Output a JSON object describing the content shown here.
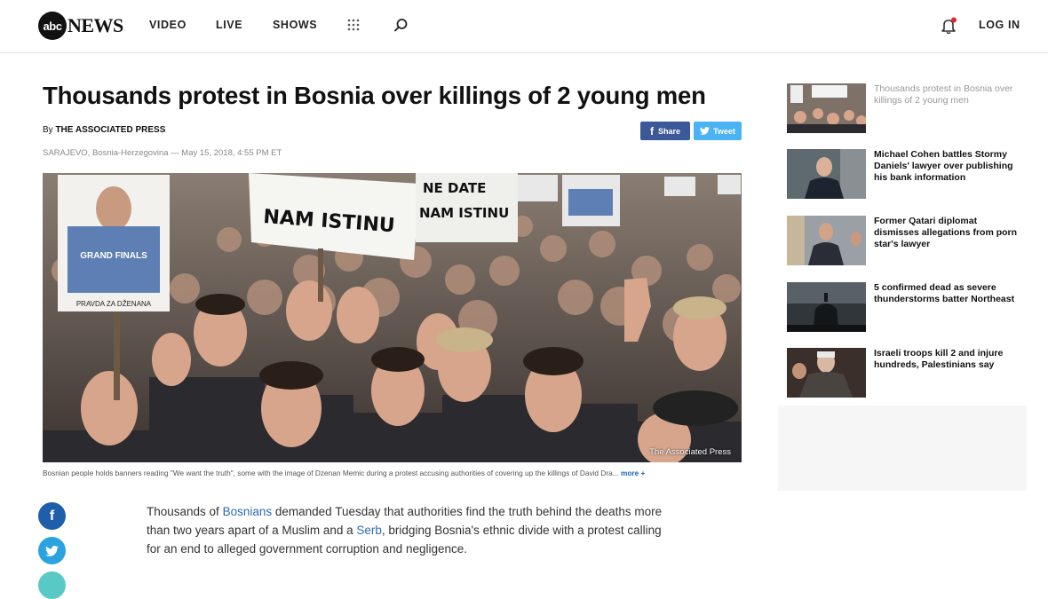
{
  "header": {
    "logo_abc": "abc",
    "logo_news": "NEWS",
    "nav": [
      "VIDEO",
      "LIVE",
      "SHOWS"
    ],
    "login": "LOG IN"
  },
  "article": {
    "headline": "Thousands protest in Bosnia over killings of 2 young men",
    "byline_prefix": "By",
    "byline_author": "THE ASSOCIATED PRESS",
    "dateline": "SARAJEVO, Bosnia-Herzegovina — May 15, 2018, 4:55 PM ET",
    "share": {
      "facebook": "Share",
      "twitter": "Tweet"
    },
    "image_credit": "The Associated Press",
    "caption": "Bosnian people holds banners reading \"We want the truth\", some with the image of Dzenan Memic during a protest accusing authorities of covering up the killings of David Dra...",
    "caption_more": "more +",
    "body": {
      "p1": "Thousands of",
      "link1": "Bosnians",
      "p2": "demanded Tuesday that authorities find the truth behind the deaths more than two years apart of a Muslim and a",
      "link2": "Serb",
      "p3": ", bridging Bosnia's ethnic divide with a protest calling for an end to alleged government corruption and negligence."
    },
    "photo_signs": {
      "sign1": "NAM ISTINU",
      "sign2": "NE DATE",
      "sign3": "NAM ISTINU",
      "sign4": "PRAVDA ZA DŽENANA",
      "shirt": "GRAND FINALS"
    }
  },
  "sidebar": {
    "items": [
      {
        "title": "Thousands protest in Bosnia over killings of 2 young men",
        "current": true
      },
      {
        "title": "Michael Cohen battles Stormy Daniels' lawyer over publishing his bank information",
        "current": false
      },
      {
        "title": "Former Qatari diplomat dismisses allegations from porn star's lawyer",
        "current": false
      },
      {
        "title": "5 confirmed dead as severe thunderstorms batter Northeast",
        "current": false
      },
      {
        "title": "Israeli troops kill 2 and injure hundreds, Palestinians say",
        "current": false
      }
    ]
  },
  "colors": {
    "facebook": "#3b5998",
    "twitter": "#4ab3f4",
    "link": "#2d6bb0",
    "notification_dot": "#e0262b"
  }
}
